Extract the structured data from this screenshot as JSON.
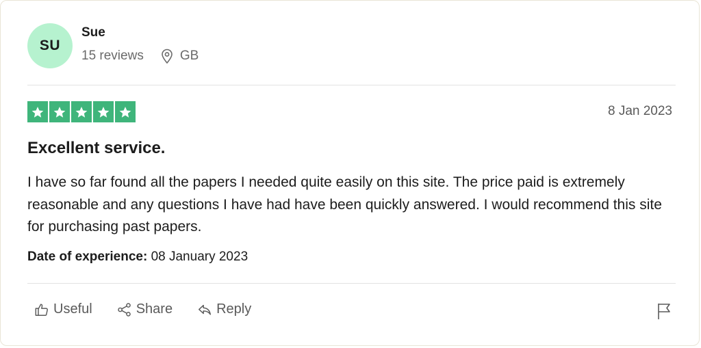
{
  "reviewer": {
    "initials": "SU",
    "name": "Sue",
    "reviews_count": "15 reviews",
    "location": "GB"
  },
  "rating": {
    "stars": 5,
    "max": 5,
    "color": "#3fb57b"
  },
  "review": {
    "date": "8 Jan 2023",
    "title": "Excellent service.",
    "body": "I have so far found all the papers I needed quite easily on this site. The price paid is extremely reasonable and any questions I have had have been quickly answered. I would recommend this site for purchasing past papers.",
    "experience_label": "Date of experience:",
    "experience_value": "08 January 2023"
  },
  "actions": {
    "useful": "Useful",
    "share": "Share",
    "reply": "Reply"
  },
  "icons": {
    "location": "location-pin-icon",
    "useful": "thumbs-up-icon",
    "share": "share-icon",
    "reply": "reply-icon",
    "flag": "flag-icon"
  }
}
